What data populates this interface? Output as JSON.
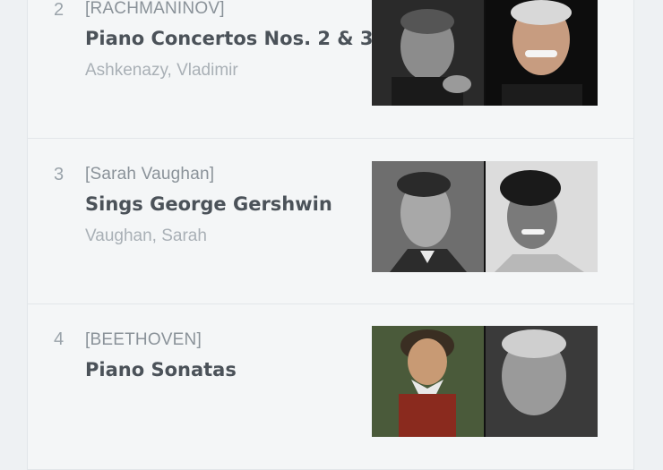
{
  "items": [
    {
      "number": "2",
      "composer": "[RACHMANINOV]",
      "title": "Piano Concertos Nos. 2 & 3",
      "artist": "Ashkenazy, Vladimir",
      "portraits": [
        "portrait-photo-composer",
        "portrait-photo-pianist"
      ]
    },
    {
      "number": "3",
      "composer": "[Sarah Vaughan]",
      "title": "Sings George Gershwin",
      "artist": "Vaughan, Sarah",
      "portraits": [
        "portrait-photo-composer",
        "portrait-photo-singer"
      ]
    },
    {
      "number": "4",
      "composer": "[BEETHOVEN]",
      "title": "Piano Sonatas",
      "artist": "",
      "portraits": [
        "portrait-painting-composer",
        "portrait-photo-pianist"
      ]
    }
  ]
}
